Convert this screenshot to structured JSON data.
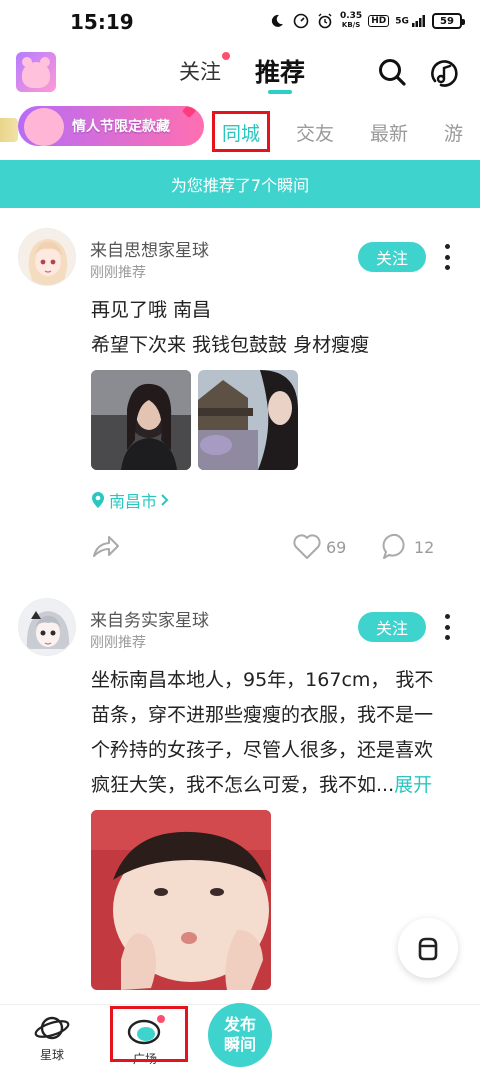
{
  "status_bar": {
    "time": "15:19",
    "net_speed_value": "0.35",
    "net_speed_unit": "KB/S",
    "hd": "HD",
    "signal": "5G",
    "battery": "59"
  },
  "header": {
    "tab_follow": "关注",
    "tab_recommend": "推荐"
  },
  "categories": {
    "banner": "情人节限定款藏",
    "tabs": [
      "同城",
      "交友",
      "最新",
      "游"
    ]
  },
  "recommend_strip": "为您推荐了7个瞬间",
  "posts": [
    {
      "from": "来自思想家星球",
      "time": "刚刚推荐",
      "follow": "关注",
      "lines": [
        "再见了哦  南昌",
        "希望下次来  我钱包鼓鼓  身材瘦瘦"
      ],
      "location": "南昌市",
      "likes": "69",
      "comments": "12"
    },
    {
      "from": "来自务实家星球",
      "time": "刚刚推荐",
      "follow": "关注",
      "lines": [
        "坐标南昌本地人，95年，167cm，  我不",
        "苗条，穿不进那些瘦瘦的衣服，我不是一",
        "个矜持的女孩子，尽管人很多，还是喜欢",
        "疯狂大笑，我不怎么可爱，我不如..."
      ],
      "expand": "展开"
    }
  ],
  "bottom_nav": {
    "planet": "星球",
    "square": "广场",
    "publish_line1": "发布",
    "publish_line2": "瞬间"
  },
  "colors": {
    "accent": "#3fd3cd",
    "highlight_box": "#e5131b"
  }
}
